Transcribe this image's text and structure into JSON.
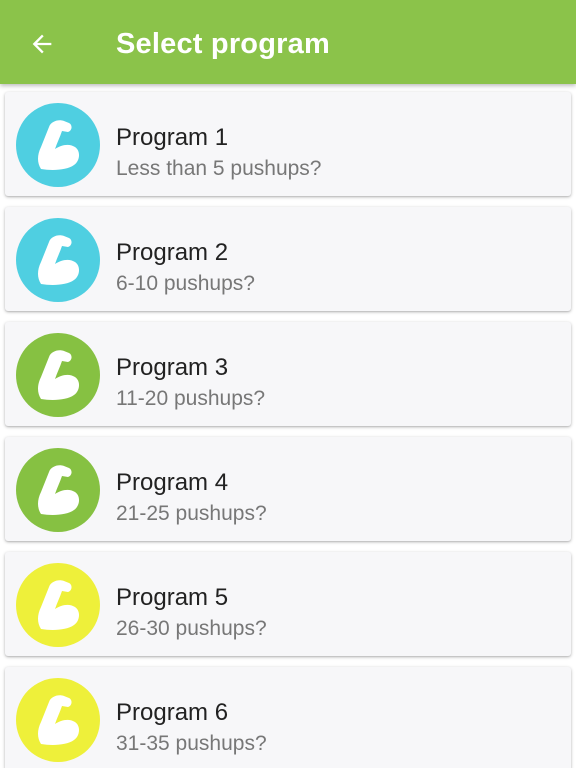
{
  "app_bar": {
    "title": "Select program",
    "background_color": "#8BC34A",
    "back_icon": "arrow-left-icon"
  },
  "programs": [
    {
      "title": "Program 1",
      "subtitle": "Less than 5 pushups?",
      "color": "#4FCFE1",
      "icon": "flexed-arm-icon"
    },
    {
      "title": "Program 2",
      "subtitle": "6-10 pushups?",
      "color": "#4FCFE1",
      "icon": "flexed-arm-icon"
    },
    {
      "title": "Program 3",
      "subtitle": "11-20 pushups?",
      "color": "#86C142",
      "icon": "flexed-arm-icon"
    },
    {
      "title": "Program 4",
      "subtitle": "21-25 pushups?",
      "color": "#86C142",
      "icon": "flexed-arm-icon"
    },
    {
      "title": "Program 5",
      "subtitle": "26-30 pushups?",
      "color": "#EEF03A",
      "icon": "flexed-arm-icon"
    },
    {
      "title": "Program 6",
      "subtitle": "31-35 pushups?",
      "color": "#EEF03A",
      "icon": "flexed-arm-icon"
    }
  ]
}
